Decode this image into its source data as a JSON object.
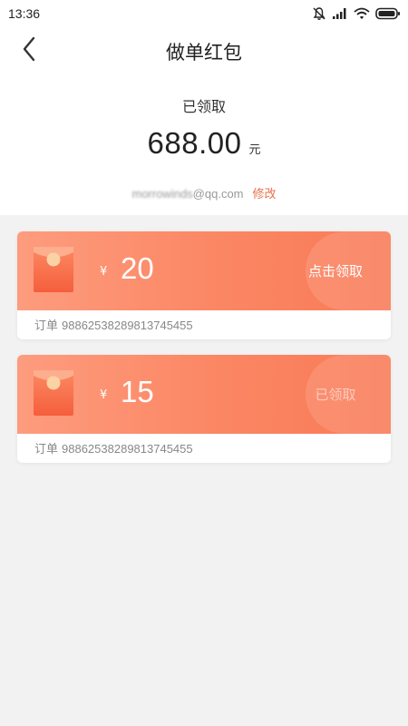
{
  "status_bar": {
    "time": "13:36",
    "icons": [
      "bell-muted-icon",
      "signal-icon",
      "wifi-icon",
      "battery-icon"
    ]
  },
  "nav": {
    "title": "做单红包",
    "back_icon": "chevron-left-icon"
  },
  "summary": {
    "label": "已领取",
    "amount": "688.00",
    "unit": "元"
  },
  "account": {
    "email_masked": "morrowinds",
    "email_domain": "@qq.com",
    "edit_label": "修改"
  },
  "coupons": [
    {
      "currency": "¥",
      "value": "20",
      "action": "点击领取",
      "order_label": "订单",
      "order_number": "98862538289813745455"
    },
    {
      "currency": "¥",
      "value": "15",
      "action": "已领取",
      "order_label": "订单",
      "order_number": "98862538289813745455"
    }
  ],
  "colors": {
    "accent": "#e8704a",
    "card_gradient_start": "#fd9c7e",
    "card_gradient_end": "#f97b57",
    "background": "#f2f2f2"
  }
}
